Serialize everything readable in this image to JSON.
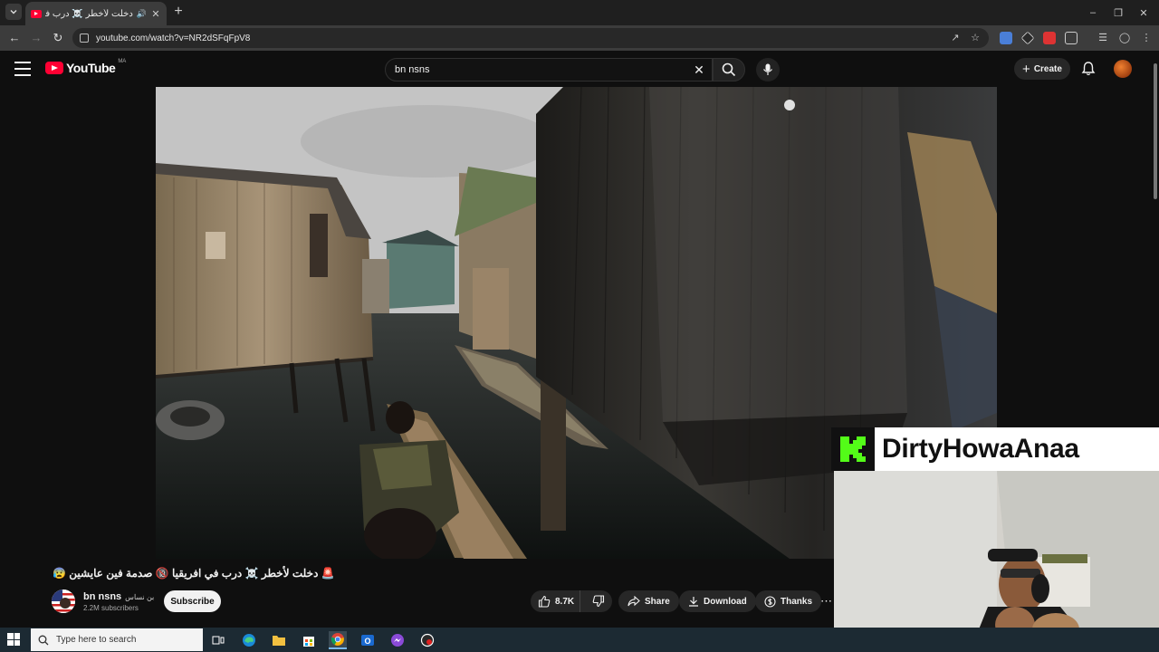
{
  "browser": {
    "tab_title": "دخلت لأخطر ☠️ درب في إفريقيا",
    "url": "youtube.com/watch?v=NR2dSFqFpV8"
  },
  "youtube": {
    "logo_text": "YouTube",
    "country_code": "MA",
    "search_value": "bn nsns",
    "create_label": "Create"
  },
  "video": {
    "title": "🚨 دخلت لأخطر ☠️ درب في افريقيا 🔞 صدمة فين عايشين 😰",
    "channel_name": "bn nsns",
    "channel_name_ar": "بن نساس",
    "subscribers": "2.2M subscribers",
    "subscribe_label": "Subscribe",
    "likes": "8.7K",
    "share_label": "Share",
    "download_label": "Download",
    "thanks_label": "Thanks"
  },
  "overlay": {
    "streamer_name": "DirtyHowaAnaa",
    "platform_letter": "K"
  },
  "taskbar": {
    "search_placeholder": "Type here to search"
  },
  "colors": {
    "youtube_red": "#ff0033",
    "kick_green": "#53fc18",
    "background": "#0f0f0f"
  }
}
